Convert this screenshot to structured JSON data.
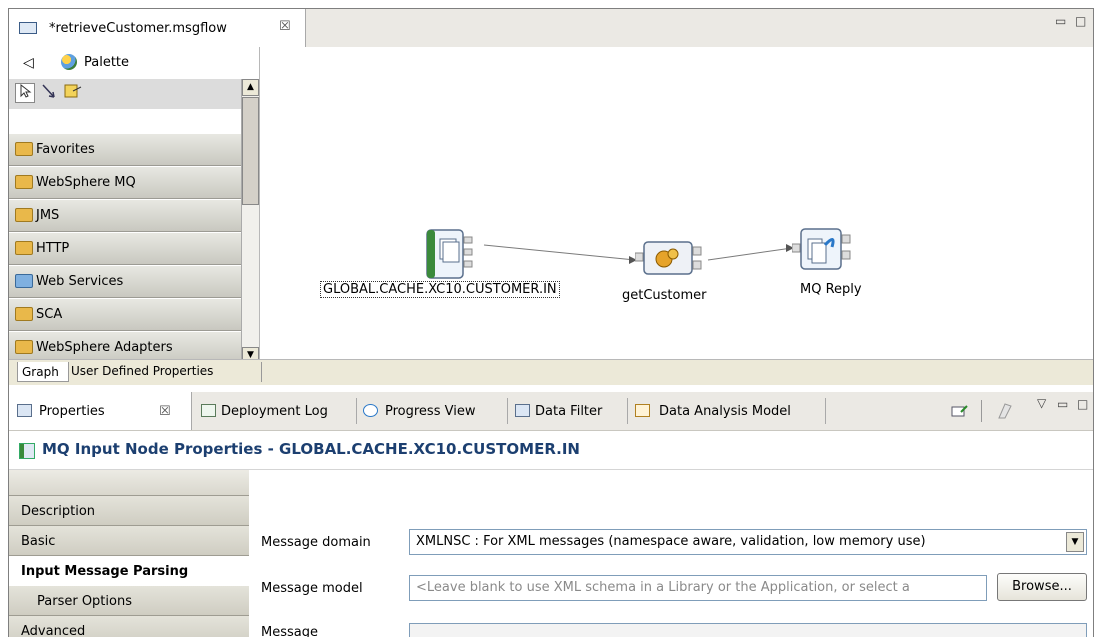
{
  "editor": {
    "tab_title": "*retrieveCustomer.msgflow",
    "tab_close": "☒",
    "window_controls": [
      "▭",
      "□"
    ]
  },
  "palette": {
    "collapse_arrow": "◁",
    "title": "Palette",
    "drawers": [
      {
        "label": "Favorites"
      },
      {
        "label": "WebSphere MQ"
      },
      {
        "label": "JMS"
      },
      {
        "label": "HTTP"
      },
      {
        "label": "Web Services"
      },
      {
        "label": "SCA"
      },
      {
        "label": "WebSphere Adapters"
      }
    ]
  },
  "flow": {
    "nodes": [
      {
        "label": "GLOBAL.CACHE.XC10.CUSTOMER.IN",
        "icon": "mq-input-icon"
      },
      {
        "label": "getCustomer",
        "icon": "compute-gears-icon"
      },
      {
        "label": "MQ Reply",
        "icon": "mq-reply-icon"
      }
    ]
  },
  "editor_bottom_tabs": [
    "Graph",
    "User Defined Properties"
  ],
  "views": {
    "tabs": [
      {
        "label": "Properties"
      },
      {
        "label": "Deployment Log"
      },
      {
        "label": "Progress View"
      },
      {
        "label": "Data Filter"
      },
      {
        "label": "Data Analysis Model"
      }
    ],
    "properties_close": "☒"
  },
  "properties": {
    "title": "MQ Input Node Properties - GLOBAL.CACHE.XC10.CUSTOMER.IN",
    "nav": [
      {
        "label": "Description"
      },
      {
        "label": "Basic"
      },
      {
        "label": "Input Message Parsing"
      },
      {
        "label": "Parser Options"
      },
      {
        "label": "Advanced"
      }
    ],
    "fields": {
      "message_domain_label": "Message domain",
      "message_domain_value": "XMLNSC : For XML messages (namespace aware, validation, low memory use)",
      "message_model_label": "Message model",
      "message_model_placeholder": "<Leave blank to use XML schema in a Library or the Application, or select a",
      "browse_label": "Browse...",
      "message_label": "Message"
    }
  },
  "colors": {
    "title_blue": "#1c3f70",
    "connection_gray": "#7a7a7a"
  }
}
